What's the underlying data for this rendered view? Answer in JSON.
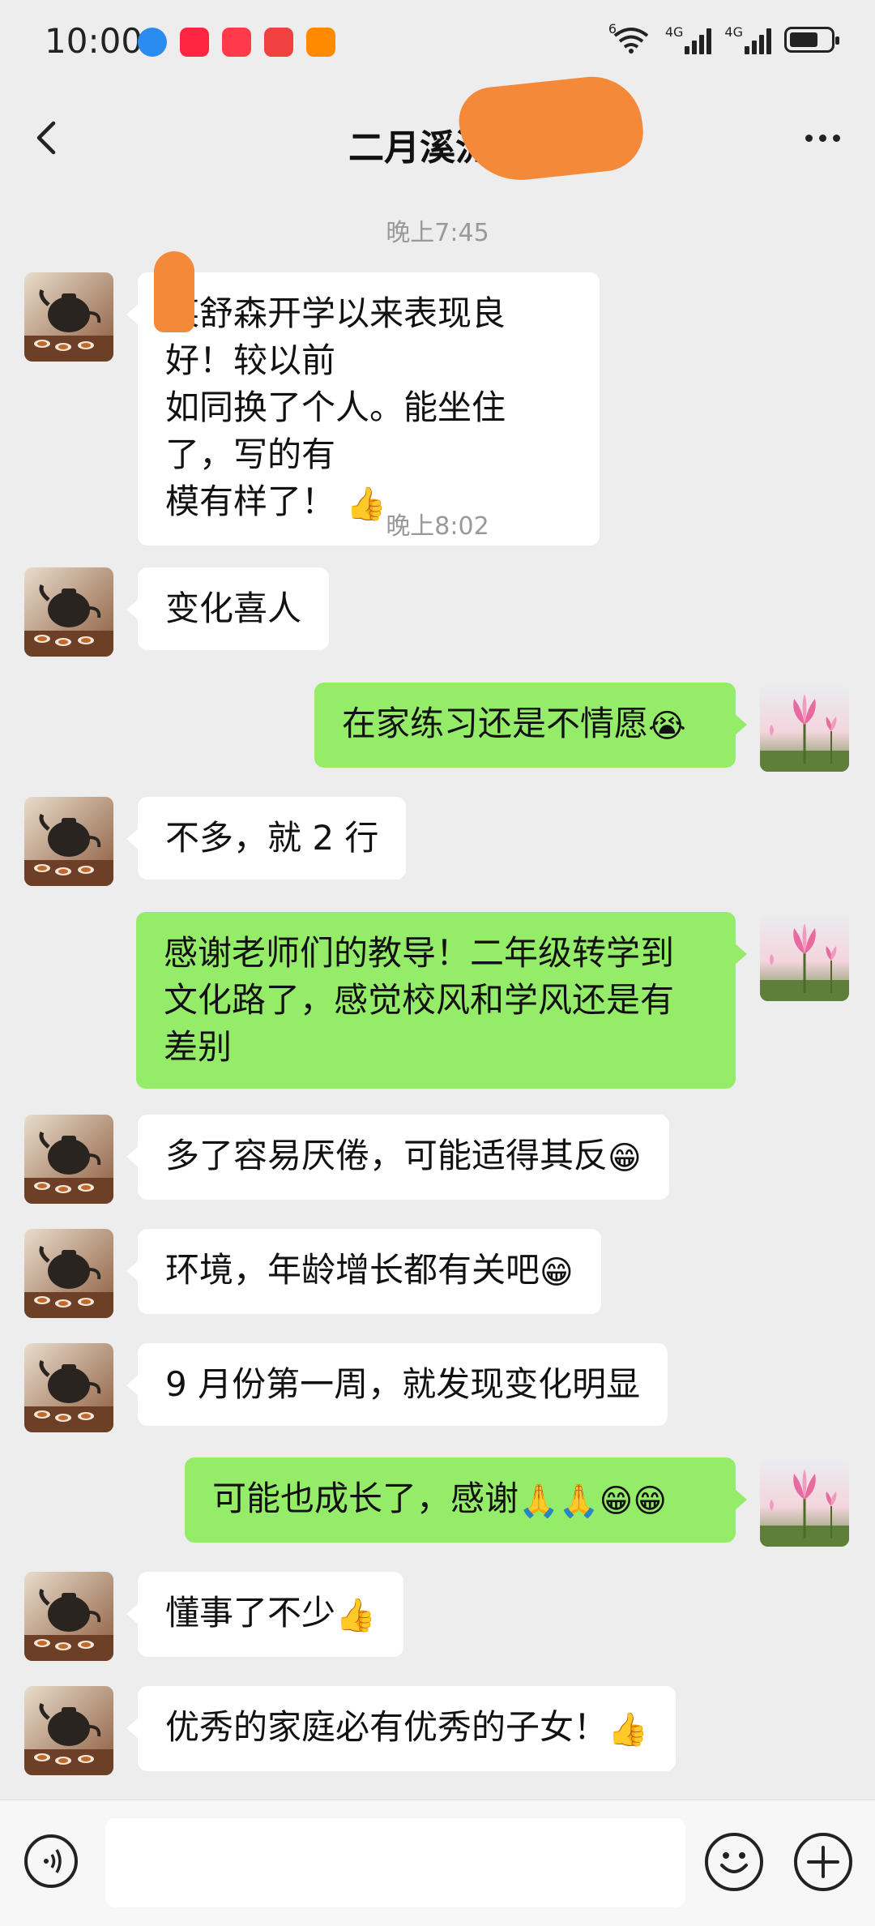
{
  "status_bar": {
    "time": "10:00",
    "network_1": "4G",
    "network_2": "4G",
    "wifi_badge": "6"
  },
  "header": {
    "title": "二月溪流宋"
  },
  "messages": [
    {
      "type": "time",
      "text": "晚上7:45"
    },
    {
      "type": "msg",
      "side": "left",
      "lines": [
        "某舒森开学以来表现良好！较以前",
        "如同换了个人。能坐住了，写的有",
        "模有样了！"
      ],
      "emoji": "👍"
    },
    {
      "type": "time",
      "text": "晚上8:02"
    },
    {
      "type": "msg",
      "side": "left",
      "text": "变化喜人"
    },
    {
      "type": "msg",
      "side": "right",
      "text": "在家练习还是不情愿",
      "emoji": "😭"
    },
    {
      "type": "msg",
      "side": "left",
      "text": "不多，就 2 行"
    },
    {
      "type": "msg",
      "side": "right",
      "lines": [
        "感谢老师们的教导！二年级转学到",
        "文化路了，感觉校风和学风还是有",
        "差别"
      ]
    },
    {
      "type": "msg",
      "side": "left",
      "text": "多了容易厌倦，可能适得其反",
      "emoji": "😁"
    },
    {
      "type": "msg",
      "side": "left",
      "text": "环境，年龄增长都有关吧",
      "emoji": "😁"
    },
    {
      "type": "msg",
      "side": "left",
      "text": "9 月份第一周，就发现变化明显"
    },
    {
      "type": "msg",
      "side": "right",
      "text": "可能也成长了，感谢",
      "emoji": "🙏🙏😁😁"
    },
    {
      "type": "msg",
      "side": "left",
      "text": "懂事了不少",
      "emoji": "👍"
    },
    {
      "type": "msg",
      "side": "left",
      "text": "优秀的家庭必有优秀的子女！",
      "emoji": "👍"
    }
  ],
  "input": {
    "placeholder": ""
  },
  "colors": {
    "bg": "#ededed",
    "bubble_left": "#ffffff",
    "bubble_right": "#95ec69",
    "redaction": "#f5893a"
  },
  "icons": [
    "back-icon",
    "more-icon",
    "voice-icon",
    "emoji-icon",
    "plus-icon"
  ]
}
